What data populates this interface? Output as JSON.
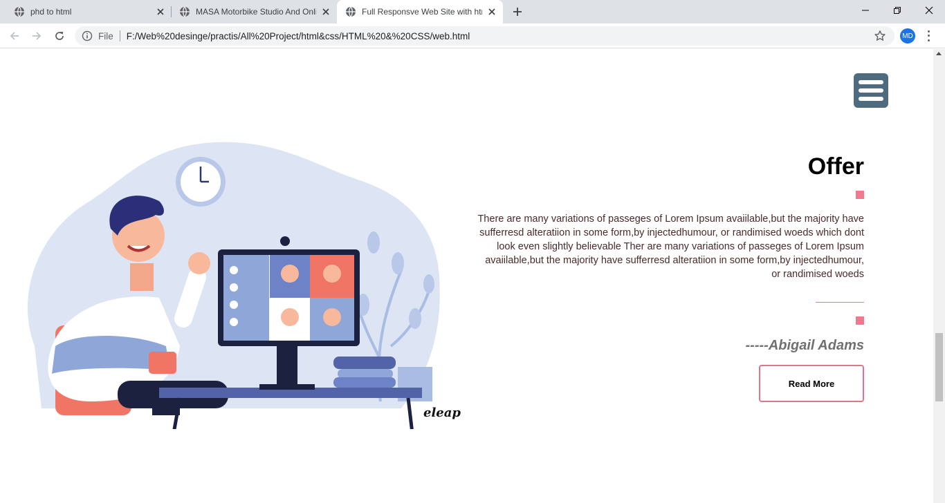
{
  "browser": {
    "tabs": [
      {
        "title": "phd to html",
        "active": false
      },
      {
        "title": "MASA Motorbike Studio And Online",
        "active": false
      },
      {
        "title": "Full Responsve Web Site with html",
        "active": true
      }
    ],
    "address": {
      "scheme_label": "File",
      "url": "F:/Web%20desinge/practis/All%20Project/html&css/HTML%20&%20CSS/web.html"
    },
    "profile_initials": "MD"
  },
  "page": {
    "section_title": "Offer",
    "body_text": "There are many variations of passeges of Lorem Ipsum avaiilable,but the majority have sufferresd alteratiion in some form,by injectedhumour, or randimised woeds which dont look even slightly believable Ther are many variations of passeges of Lorem Ipsum avaiilable,but the majority have sufferresd alteratiion in some form,by injectedhumour, or randimised woeds",
    "author": "-----Abigail Adams",
    "read_more_label": "Read More",
    "illustration_logo": "eleap"
  },
  "colors": {
    "accent_pink": "#f07990",
    "menu_button": "#4e6b80",
    "illustration_bg": "#dde4f3"
  }
}
